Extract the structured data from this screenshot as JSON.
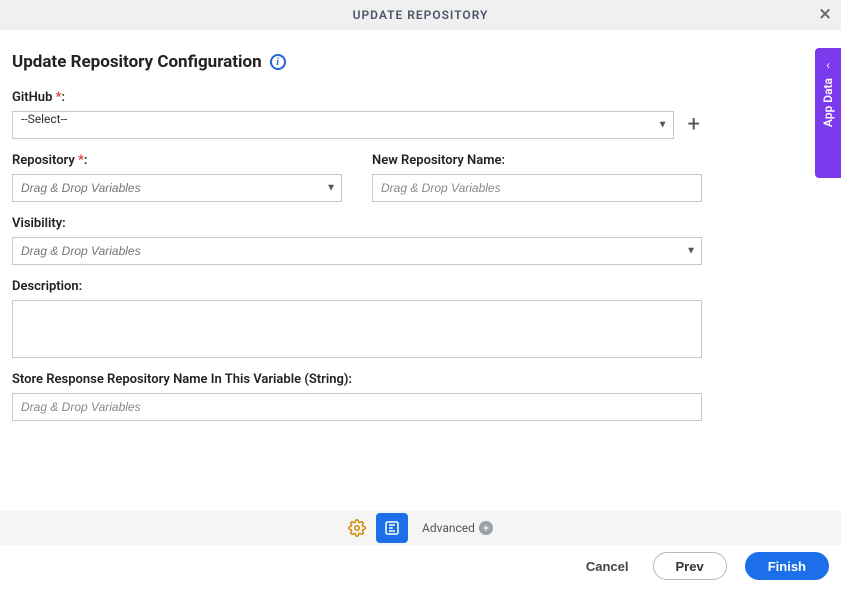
{
  "titlebar": {
    "title": "UPDATE REPOSITORY"
  },
  "page": {
    "heading": "Update Repository Configuration"
  },
  "sidebar": {
    "appData": "App Data"
  },
  "fields": {
    "github": {
      "label": "GitHub",
      "selectedText": "--Select--"
    },
    "repository": {
      "label": "Repository",
      "placeholder": "Drag & Drop Variables"
    },
    "newRepoName": {
      "label": "New Repository Name:",
      "placeholder": "Drag & Drop Variables"
    },
    "visibility": {
      "label": "Visibility:",
      "placeholder": "Drag & Drop Variables"
    },
    "description": {
      "label": "Description:"
    },
    "storeResponse": {
      "label": "Store Response Repository Name In This Variable (String):",
      "placeholder": "Drag & Drop Variables"
    }
  },
  "footer": {
    "advanced": "Advanced",
    "cancel": "Cancel",
    "prev": "Prev",
    "finish": "Finish"
  }
}
